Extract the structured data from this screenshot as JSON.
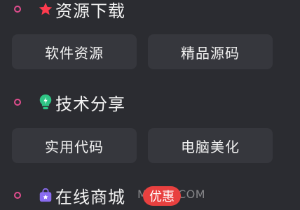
{
  "sections": [
    {
      "title": "资源下载",
      "icon": "red-star-icon"
    },
    {
      "title": "技术分享",
      "icon": "green-lightbulb-icon"
    },
    {
      "title": "在线商城",
      "icon": "purple-shopping-bag-icon",
      "badge": "优惠"
    }
  ],
  "buttons": {
    "row1": [
      "软件资源",
      "精品源码"
    ],
    "row2": [
      "实用代码",
      "电脑美化"
    ]
  },
  "watermark": "M⋅⋅⋅88.COM",
  "colors": {
    "background": "#2b2c31",
    "button_bg": "#36373d",
    "ring": "#e14d8e",
    "badge": "#e8403f"
  }
}
